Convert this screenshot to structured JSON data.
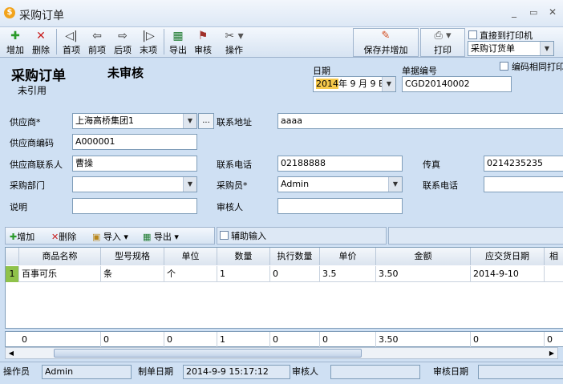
{
  "window": {
    "title": "采购订单",
    "min": "_",
    "max": "▭",
    "close": "✕"
  },
  "toolbar": {
    "add": "增加",
    "delete": "删除",
    "first": "首项",
    "prev": "前项",
    "next": "后项",
    "last": "末项",
    "export": "导出",
    "audit": "审核",
    "operate": "操作",
    "save_add": "保存并增加",
    "print": "打印",
    "print_direct": "直接到打印机",
    "print_template": "采购订货单"
  },
  "header": {
    "title": "采购订单",
    "status": "未审核",
    "ref_status": "未引用",
    "date_label": "日期",
    "date_year": "2014",
    "date_rest": "年 9 月 9 E",
    "docno_label": "单据编号",
    "docno_value": "CGD20140002",
    "same_print": "编码相同打印"
  },
  "form": {
    "supplier_label": "供应商*",
    "supplier_value": "上海高桥集团1",
    "ellipsis": "...",
    "address_label": "联系地址",
    "address_value": "aaaa",
    "supplier_code_label": "供应商编码",
    "supplier_code_value": "A000001",
    "contact_label": "供应商联系人",
    "contact_value": "曹操",
    "phone_label": "联系电话",
    "phone_value": "02188888",
    "fax_label": "传真",
    "fax_value": "0214235235",
    "dept_label": "采购部门",
    "dept_value": "",
    "buyer_label": "采购员*",
    "buyer_value": "Admin",
    "buyer_phone_label": "联系电话",
    "buyer_phone_value": "",
    "note_label": "说明",
    "note_value": "",
    "auditor_label": "审核人",
    "auditor_value": ""
  },
  "grid_toolbar": {
    "add": "增加",
    "delete": "删除",
    "import": "导入",
    "export": "导出",
    "assist": "辅助输入"
  },
  "grid": {
    "columns": [
      "商品名称",
      "型号规格",
      "单位",
      "数量",
      "执行数量",
      "单价",
      "金额",
      "应交货日期",
      "相"
    ],
    "rows": [
      {
        "index": "1",
        "cells": [
          "百事可乐",
          "条",
          "个",
          "1",
          "0",
          "3.5",
          "3.50",
          "2014-9-10",
          ""
        ]
      }
    ],
    "totals": [
      "0",
      "0",
      "0",
      "1",
      "0",
      "0",
      "3.50",
      "0",
      "0"
    ]
  },
  "statusbar": {
    "operator_label": "操作员",
    "operator_value": "Admin",
    "created_label": "制单日期",
    "created_value": "2014-9-9 15:17:12",
    "auditor_label": "审核人",
    "auditor_value": "",
    "audit_date_label": "审核日期",
    "audit_date_value": ""
  },
  "colors": {
    "accent": "#1f5fbf",
    "window_bg": "#cfe0f3",
    "titlebar": "#e8f0fa"
  }
}
